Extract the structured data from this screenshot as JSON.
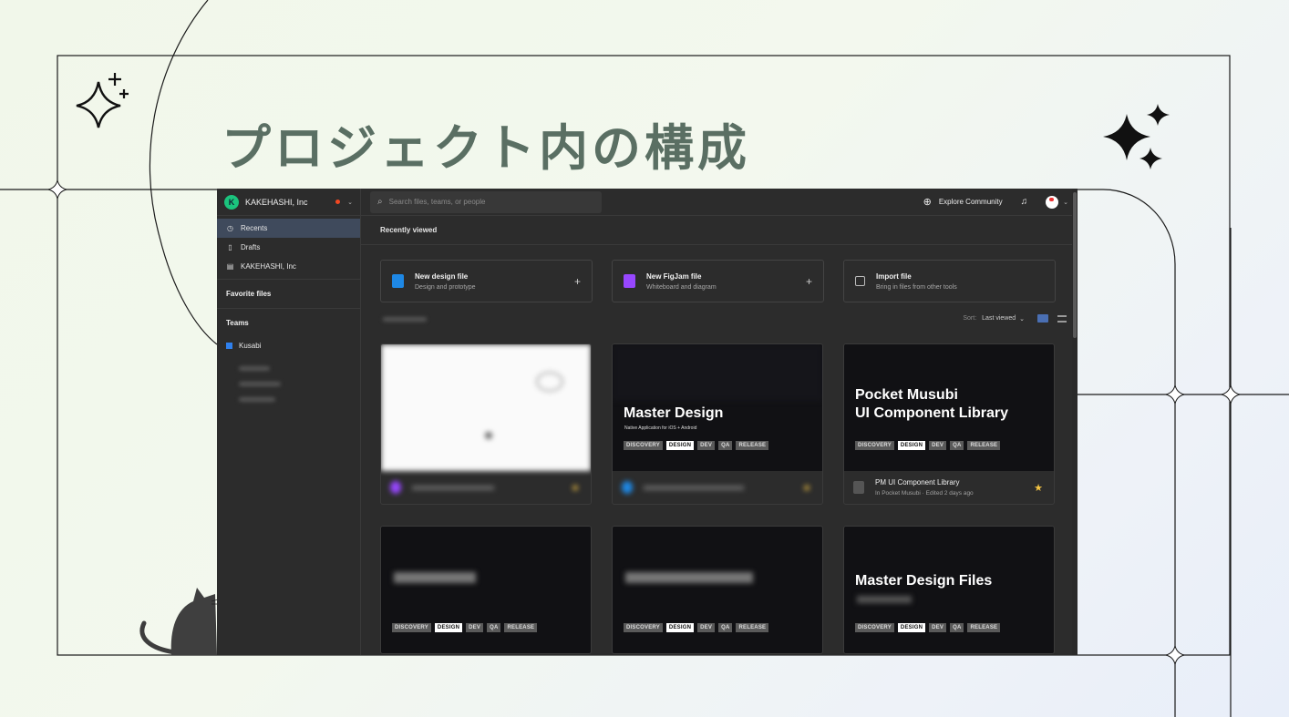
{
  "slide": {
    "title": "プロジェクト内の構成"
  },
  "app": {
    "team_name": "KAKEHASHI, Inc",
    "team_initial": "K",
    "nav": [
      {
        "label": "Recents",
        "icon": "clock-icon"
      },
      {
        "label": "Drafts",
        "icon": "file-icon"
      },
      {
        "label": "KAKEHASHI, Inc",
        "icon": "building-icon"
      }
    ],
    "favorites_label": "Favorite files",
    "teams_label": "Teams",
    "team_item": "Kusabi",
    "search_placeholder": "Search files, teams, or people",
    "explore_label": "Explore Community",
    "recent_heading": "Recently viewed",
    "actions": [
      {
        "title": "New design file",
        "subtitle": "Design and prototype",
        "color": "#1e88e5"
      },
      {
        "title": "New FigJam file",
        "subtitle": "Whiteboard and diagram",
        "color": "#9747ff"
      },
      {
        "title": "Import file",
        "subtitle": "Bring in files from other tools",
        "color": ""
      }
    ],
    "sort_label": "Sort:",
    "sort_value": "Last viewed",
    "tags": [
      "DISCOVERY",
      "DESIGN",
      "DEV",
      "QA",
      "RELEASE"
    ],
    "cards": [
      {
        "title": "",
        "subtitle": ""
      },
      {
        "title": "Master Design",
        "subtitle": "Native Application for iOS + Android"
      },
      {
        "title": "Pocket Musubi\nUI Component Library",
        "subtitle": "",
        "file_name": "PM UI Component Library",
        "file_meta": "In Pocket Musubi · Edited 2 days ago"
      },
      {
        "title": "",
        "subtitle": ""
      },
      {
        "title": "",
        "subtitle": ""
      },
      {
        "title": "Master Design Files",
        "subtitle": ""
      }
    ]
  }
}
